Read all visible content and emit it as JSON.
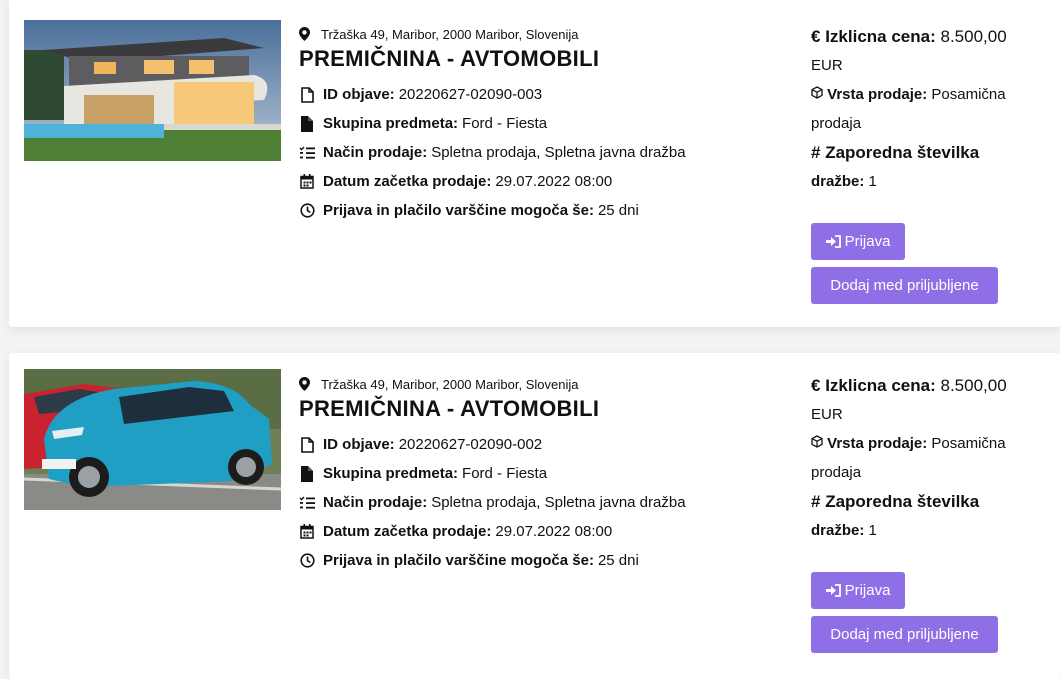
{
  "listings": [
    {
      "address": "Tržaška 49, Maribor, 2000 Maribor, Slovenija",
      "title": "PREMIČNINA - AVTOMOBILI",
      "id_label": "ID objave:",
      "id_value": "20220627-02090-003",
      "group_label": "Skupina predmeta:",
      "group_value": "Ford - Fiesta",
      "method_label": "Način prodaje:",
      "method_value": "Spletna prodaja, Spletna javna dražba",
      "start_label": "Datum začetka prodaje:",
      "start_value": "29.07.2022 08:00",
      "apply_label": "Prijava in plačilo varščine mogoča še:",
      "apply_value": "25 dni",
      "price_label": "Izklicna cena:",
      "price_value": "8.500,00",
      "price_currency": "EUR",
      "sale_type_label": "Vrsta prodaje:",
      "sale_type_value_1": "Posamična",
      "sale_type_value_2": "prodaja",
      "seq_label_1": "Zaporedna številka",
      "seq_label_2": "dražbe:",
      "seq_value": "1",
      "btn_prijava": "Prijava",
      "btn_fav": "Dodaj med priljubljene",
      "image": "house-photo"
    },
    {
      "address": "Tržaška 49, Maribor, 2000 Maribor, Slovenija",
      "title": "PREMIČNINA - AVTOMOBILI",
      "id_label": "ID objave:",
      "id_value": "20220627-02090-002",
      "group_label": "Skupina predmeta:",
      "group_value": "Ford - Fiesta",
      "method_label": "Način prodaje:",
      "method_value": "Spletna prodaja, Spletna javna dražba",
      "start_label": "Datum začetka prodaje:",
      "start_value": "29.07.2022 08:00",
      "apply_label": "Prijava in plačilo varščine mogoča še:",
      "apply_value": "25 dni",
      "price_label": "Izklicna cena:",
      "price_value": "8.500,00",
      "price_currency": "EUR",
      "sale_type_label": "Vrsta prodaje:",
      "sale_type_value_1": "Posamična",
      "sale_type_value_2": "prodaja",
      "seq_label_1": "Zaporedna številka",
      "seq_label_2": "dražbe:",
      "seq_value": "1",
      "btn_prijava": "Prijava",
      "btn_fav": "Dodaj med priljubljene",
      "image": "car-photo"
    }
  ],
  "colors": {
    "accent": "#8f6fe6",
    "card": "#ffffff",
    "background": "#f3f3f5"
  },
  "icons": {
    "address": "map-pin-icon",
    "id": "document-icon",
    "group": "file-icon",
    "method": "list-icon",
    "start": "calendar-icon",
    "apply": "clock-icon",
    "price": "euro-icon",
    "sale_type": "cube-icon",
    "seq": "hash-icon",
    "prijava": "sign-in-icon"
  }
}
